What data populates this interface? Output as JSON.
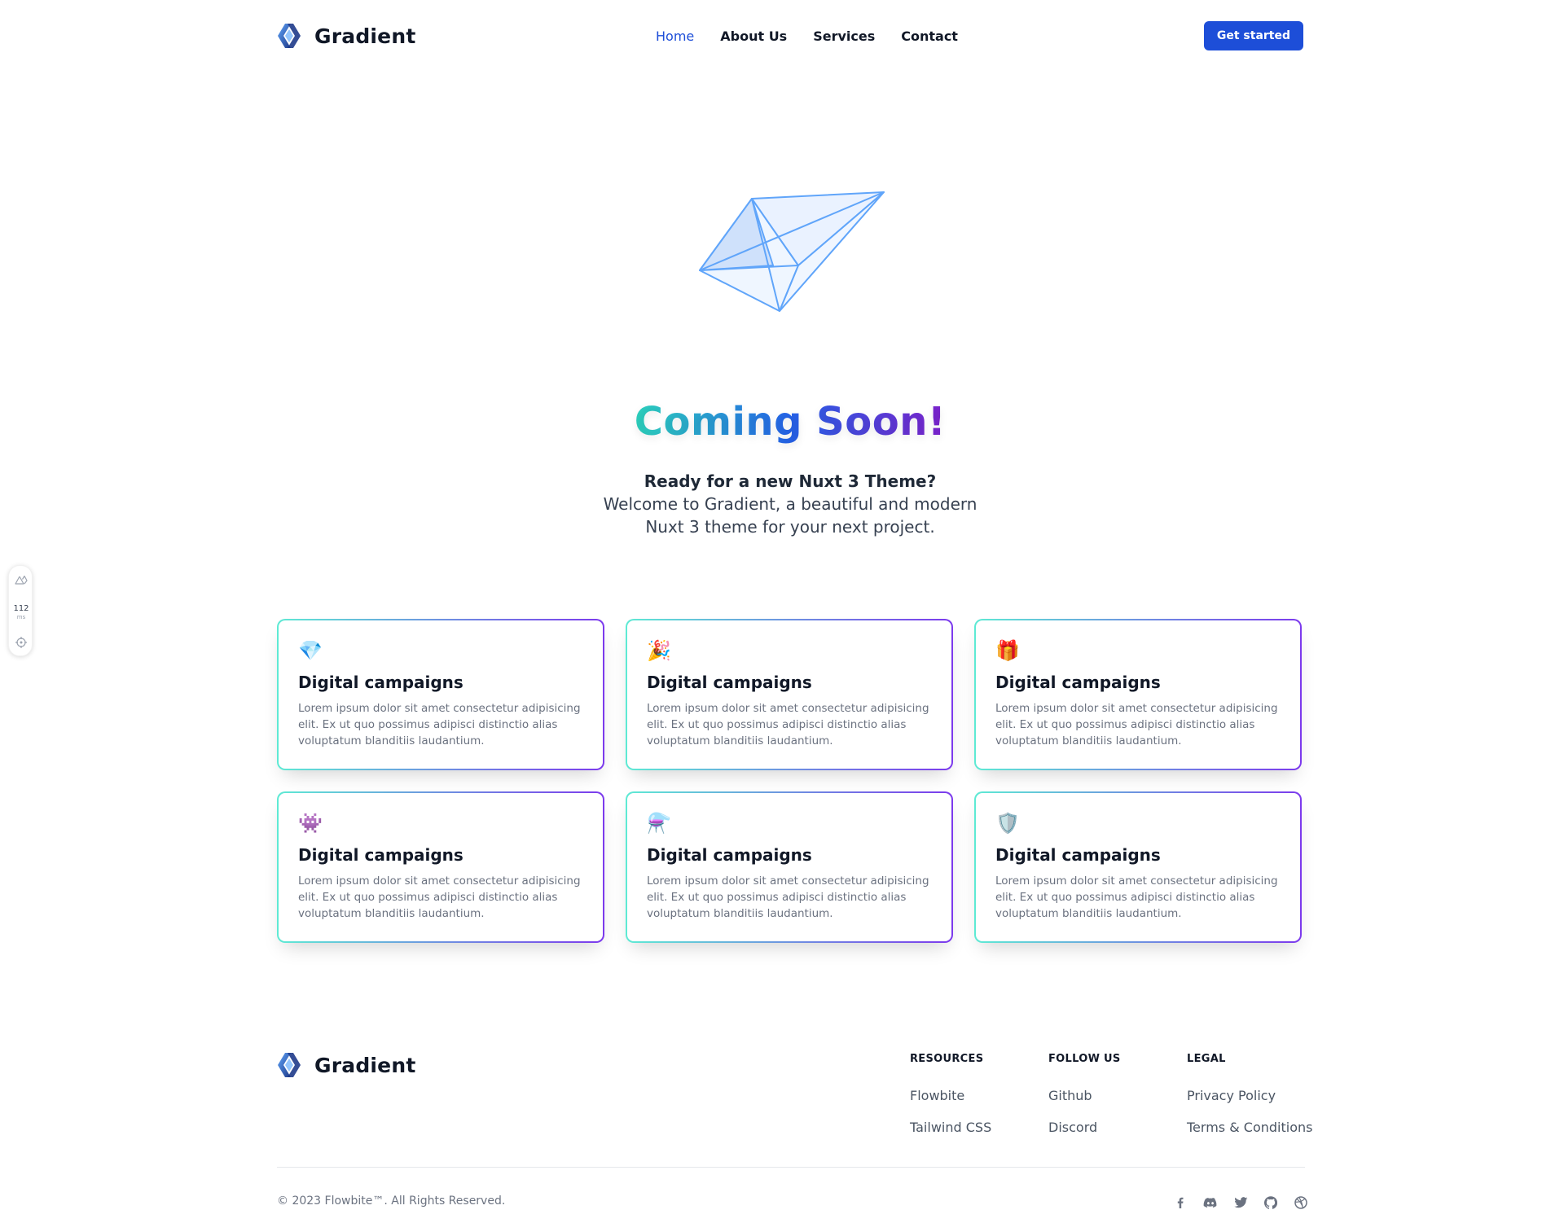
{
  "header": {
    "brand": "Gradient",
    "nav": [
      {
        "label": "Home",
        "active": true
      },
      {
        "label": "About Us",
        "active": false
      },
      {
        "label": "Services",
        "active": false
      },
      {
        "label": "Contact",
        "active": false
      }
    ],
    "cta_label": "Get started"
  },
  "hero": {
    "title": "Coming Soon!",
    "lead": "Ready for a new Nuxt 3 Theme?",
    "line1": "Welcome to Gradient, a beautiful and modern",
    "line2": "Nuxt 3 theme for your next project."
  },
  "cards": [
    {
      "icon": "💎",
      "icon_name": "gem-icon",
      "title": "Digital campaigns",
      "text": "Lorem ipsum dolor sit amet consectetur adipisicing elit. Ex ut quo possimus adipisci distinctio alias voluptatum blanditiis laudantium."
    },
    {
      "icon": "🎉",
      "icon_name": "party-popper-icon",
      "title": "Digital campaigns",
      "text": "Lorem ipsum dolor sit amet consectetur adipisicing elit. Ex ut quo possimus adipisci distinctio alias voluptatum blanditiis laudantium."
    },
    {
      "icon": "🎁",
      "icon_name": "gift-icon",
      "title": "Digital campaigns",
      "text": "Lorem ipsum dolor sit amet consectetur adipisicing elit. Ex ut quo possimus adipisci distinctio alias voluptatum blanditiis laudantium."
    },
    {
      "icon": "👾",
      "icon_name": "alien-monster-icon",
      "title": "Digital campaigns",
      "text": "Lorem ipsum dolor sit amet consectetur adipisicing elit. Ex ut quo possimus adipisci distinctio alias voluptatum blanditiis laudantium."
    },
    {
      "icon": "⚗️",
      "icon_name": "flask-icon",
      "title": "Digital campaigns",
      "text": "Lorem ipsum dolor sit amet consectetur adipisicing elit. Ex ut quo possimus adipisci distinctio alias voluptatum blanditiis laudantium."
    },
    {
      "icon": "🛡️",
      "icon_name": "shield-icon",
      "title": "Digital campaigns",
      "text": "Lorem ipsum dolor sit amet consectetur adipisicing elit. Ex ut quo possimus adipisci distinctio alias voluptatum blanditiis laudantium."
    }
  ],
  "footer": {
    "brand": "Gradient",
    "columns": [
      {
        "heading": "Resources",
        "links": [
          "Flowbite",
          "Tailwind CSS"
        ]
      },
      {
        "heading": "Follow us",
        "links": [
          "Github",
          "Discord"
        ]
      },
      {
        "heading": "Legal",
        "links": [
          "Privacy Policy",
          "Terms & Conditions"
        ]
      }
    ],
    "copyright": "© 2023 Flowbite™. All Rights Reserved.",
    "socials": [
      "facebook-icon",
      "discord-icon",
      "twitter-icon",
      "github-icon",
      "dribbble-icon"
    ]
  },
  "devtools": {
    "value": "112",
    "unit": "ms"
  },
  "colors": {
    "primary": "#1d4ed8",
    "gradient_start": "#2dd4bf",
    "gradient_mid": "#2563eb",
    "gradient_end": "#7e22ce"
  }
}
